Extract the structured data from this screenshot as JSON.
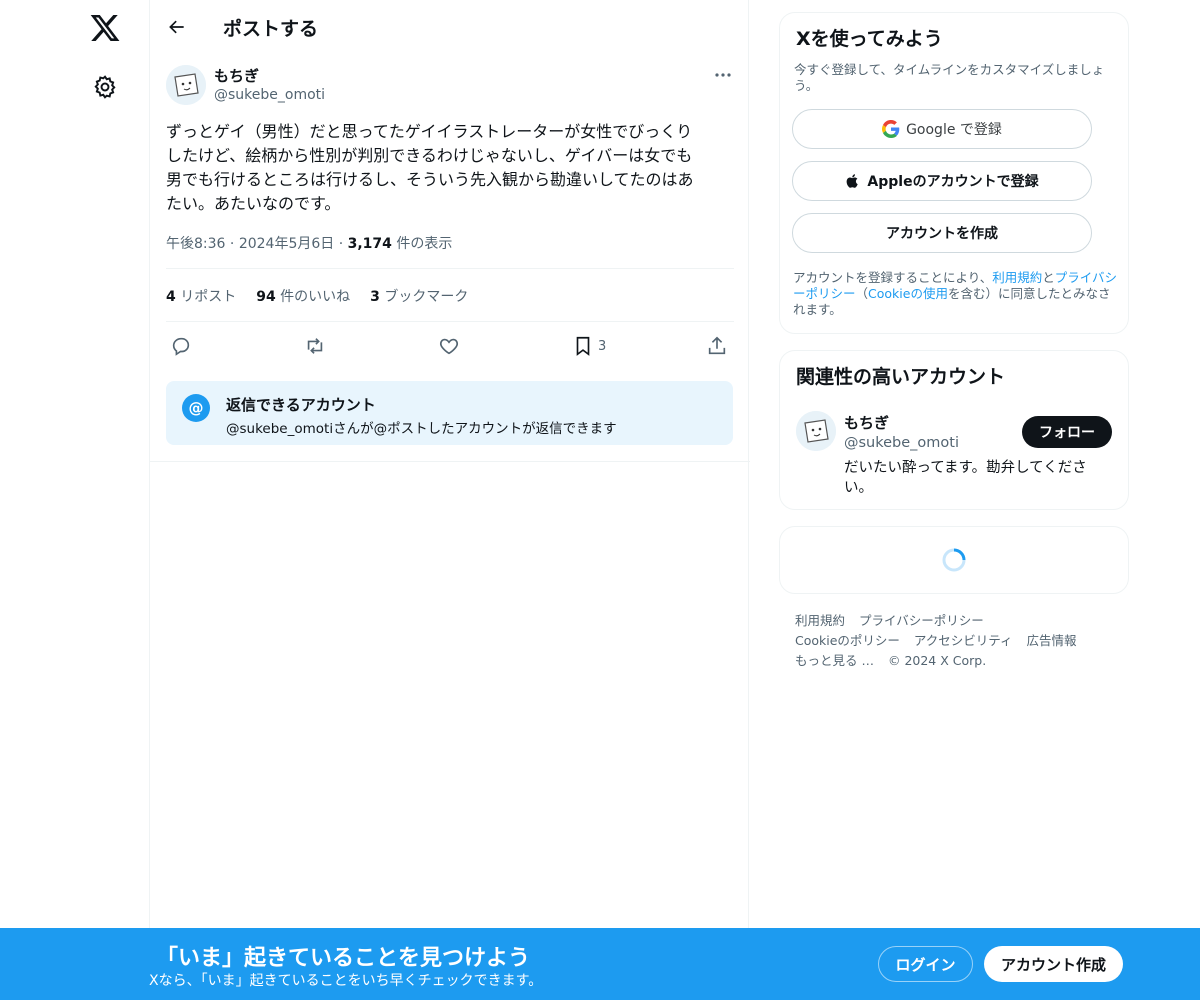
{
  "header": {
    "title": "ポストする"
  },
  "post": {
    "author_name": "もちぎ",
    "author_handle": "@sukebe_omoti",
    "text": "ずっとゲイ（男性）だと思ってたゲイイラストレーターが女性でびっくり\nしたけど、絵柄から性別が判別できるわけじゃないし、ゲイバーは女でも\n男でも行けるところは行けるし、そういう先入観から勘違いしてたのはあ\nたい。あたいなのです。",
    "time": "午後8:36",
    "date": "2024年5月6日",
    "views_count": "3,174",
    "views_label": "件の表示",
    "reposts_count": "4",
    "reposts_label": "リポスト",
    "likes_count": "94",
    "likes_label": "件のいいね",
    "bookmarks_count": "3",
    "bookmarks_label": "ブックマーク",
    "bookmark_action_count": "3"
  },
  "reply_restriction": {
    "title": "返信できるアカウント",
    "description": "@sukebe_omotiさんが@ポストしたアカウントが返信できます"
  },
  "signup_card": {
    "title": "Xを使ってみよう",
    "subtitle": "今すぐ登録して、タイムラインをカスタマイズしましょう。",
    "google_label": "Google で登録",
    "apple_label": "Appleのアカウントで登録",
    "create_label": "アカウントを作成",
    "legal_prefix": "アカウントを登録することにより、",
    "terms_link": "利用規約",
    "legal_and": "と",
    "privacy_link": "プライバシーポリシー",
    "legal_paren_open": "（",
    "cookie_link": "Cookieの使用",
    "legal_suffix": "を含む）に同意したとみなされます。"
  },
  "related_card": {
    "title": "関連性の高いアカウント",
    "name": "もちぎ",
    "handle": "@sukebe_omoti",
    "bio": "だいたい酔ってます。勘弁してください。",
    "follow_label": "フォロー"
  },
  "footer": {
    "links": [
      "利用規約",
      "プライバシーポリシー",
      "Cookieのポリシー",
      "アクセシビリティ",
      "広告情報",
      "もっと見る …"
    ],
    "copyright": "© 2024 X Corp."
  },
  "banner": {
    "title": "「いま」起きていることを見つけよう",
    "subtitle": "Xなら、「いま」起きていることをいち早くチェックできます。",
    "login_label": "ログイン",
    "signup_label": "アカウント作成"
  },
  "colors": {
    "accent": "#1d9bf0",
    "text_primary": "#0f1419",
    "text_secondary": "#536471",
    "border": "#eff3f4"
  },
  "icons": [
    "x-logo-icon",
    "gear-icon",
    "back-arrow-icon",
    "more-icon",
    "reply-icon",
    "repost-icon",
    "like-icon",
    "bookmark-icon",
    "share-icon",
    "at-icon",
    "google-icon",
    "apple-icon",
    "loading-spinner-icon"
  ]
}
